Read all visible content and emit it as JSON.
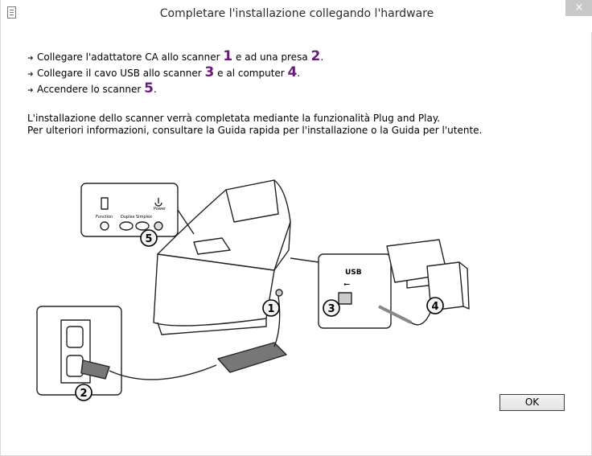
{
  "window": {
    "title": "Completare l'installazione collegando l'hardware",
    "close_glyph": "×"
  },
  "instructions": [
    {
      "before": "Collegare l'adattatore CA allo scanner ",
      "n1": "1",
      "middle": " e ad una presa ",
      "n2": "2",
      "after": "."
    },
    {
      "before": "Collegare il cavo USB allo scanner ",
      "n1": "3",
      "middle": " e al computer ",
      "n2": "4",
      "after": "."
    },
    {
      "before": "Accendere lo scanner ",
      "n1": "5",
      "after": "."
    }
  ],
  "info": {
    "line1": "L'installazione dello scanner verrà completata mediante la funzionalità Plug and Play.",
    "line2": "Per ulteriori informazioni, consultare la Guida rapida per l'installazione o la Guida per l'utente."
  },
  "diagram": {
    "panel_labels": {
      "function": "Function",
      "duplex": "Duplex",
      "simplex": "Simplex",
      "power": "Power"
    },
    "usb_label": "USB",
    "callouts": [
      "1",
      "2",
      "3",
      "4",
      "5"
    ]
  },
  "buttons": {
    "ok": "OK"
  },
  "colors": {
    "accent_number": "#6a1b7a"
  }
}
